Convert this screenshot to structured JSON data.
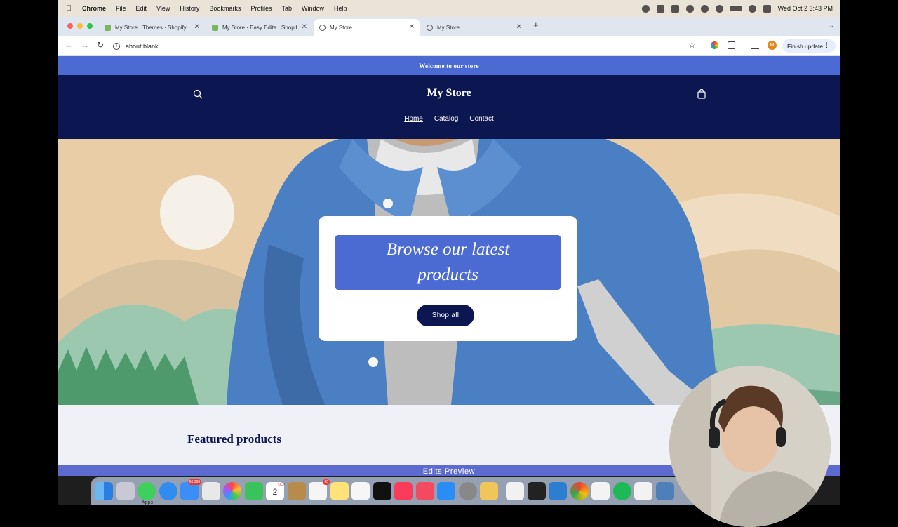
{
  "menubar": {
    "app_name": "Chrome",
    "items": [
      "File",
      "Edit",
      "View",
      "History",
      "Bookmarks",
      "Profiles",
      "Tab",
      "Window",
      "Help"
    ],
    "clock": "Wed Oct 2  3:43 PM"
  },
  "tabs": [
    {
      "title": "My Store · Themes · Shopify",
      "favicon": "shopify-icon",
      "active": false
    },
    {
      "title": "My Store · Easy Edits · Shopif",
      "favicon": "shopify-icon",
      "active": false
    },
    {
      "title": "My Store",
      "favicon": "globe-icon",
      "active": true
    },
    {
      "title": "My Store",
      "favicon": "globe-icon",
      "active": false
    }
  ],
  "toolbar": {
    "url": "about:blank",
    "finish_update": "Finish update",
    "profile_initial": "M"
  },
  "store": {
    "announcement": "Welcome to our store",
    "title": "My Store",
    "nav": [
      "Home",
      "Catalog",
      "Contact"
    ],
    "hero": {
      "heading_line1": "Browse our latest",
      "heading_line2": "products",
      "button": "Shop all"
    },
    "featured_heading": "Featured products"
  },
  "edits_preview": "Edits Preview",
  "dock": {
    "mail_badge": "66,390",
    "reminders_badge": "60",
    "calendar_month": "OCT",
    "calendar_day": "2",
    "apps_label": "Apps"
  },
  "colors": {
    "brand_blue": "#4b6bd3",
    "brand_navy": "#0c1650"
  }
}
